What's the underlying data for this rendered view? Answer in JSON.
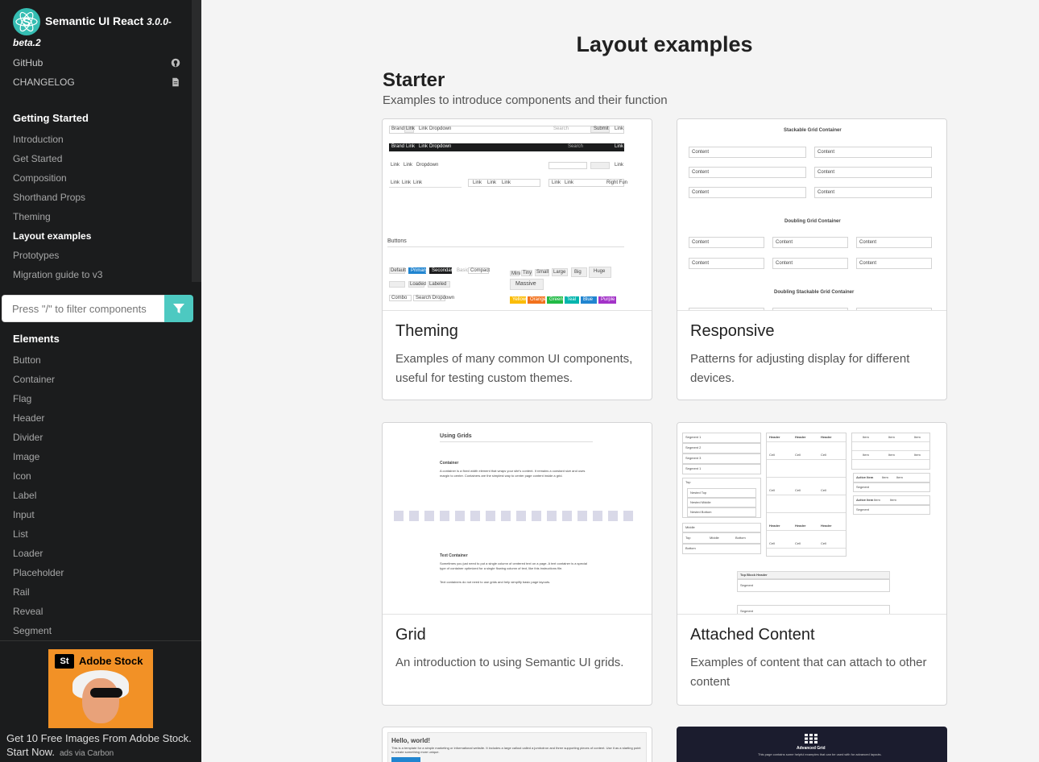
{
  "sidebar": {
    "brand_name": "Semantic UI React",
    "version_a": "3.0.0-",
    "version_b": "beta.2",
    "links": [
      {
        "label": "GitHub"
      },
      {
        "label": "CHANGELOG"
      }
    ],
    "getting_started_header": "Getting Started",
    "getting_started": [
      "Introduction",
      "Get Started",
      "Composition",
      "Shorthand Props",
      "Theming",
      "Layout examples",
      "Prototypes",
      "Migration guide to v3"
    ],
    "filter_placeholder": "Press \"/\" to filter components",
    "elements_header": "Elements",
    "elements": [
      "Button",
      "Container",
      "Flag",
      "Header",
      "Divider",
      "Image",
      "Icon",
      "Label",
      "Input",
      "List",
      "Loader",
      "Placeholder",
      "Rail",
      "Reveal",
      "Segment"
    ]
  },
  "ad": {
    "logo_text": "St",
    "brand": "Adobe Stock",
    "text": "Get 10 Free Images From Adobe Stock. Start Now.",
    "via": "ads via Carbon"
  },
  "main": {
    "title": "Layout examples",
    "section_title": "Starter",
    "section_subtitle": "Examples to introduce components and their function",
    "cards": [
      {
        "title": "Theming",
        "desc": "Examples of many common UI components, useful for testing custom themes."
      },
      {
        "title": "Responsive",
        "desc": "Patterns for adjusting display for different devices."
      },
      {
        "title": "Grid",
        "desc": "An introduction to using Semantic UI grids."
      },
      {
        "title": "Attached Content",
        "desc": "Examples of content that can attach to other content"
      }
    ]
  },
  "thumbs": {
    "theming": {
      "menu": [
        "Brand",
        "Link",
        "Link",
        "Dropdown"
      ],
      "search": "Search",
      "submit": "Submit",
      "link": "Link",
      "tabs": [
        "Link",
        "Link",
        "Link"
      ],
      "right_fun": "Right Fun",
      "buttons_label": "Buttons",
      "buttons": [
        "Default",
        "Primary",
        "Secondary",
        "Basic",
        "Compact"
      ],
      "sizes": [
        "Mini",
        "Tiny",
        "Small",
        "Large",
        "Big",
        "Huge"
      ],
      "massive": "Massive",
      "loaded": "Loaded",
      "labeled": "Labeled",
      "combo": "Combo",
      "search_dropdown": "Search Dropdown",
      "colors": [
        {
          "label": "Yellow",
          "color": "#fbbd08"
        },
        {
          "label": "Orange",
          "color": "#f2711c"
        },
        {
          "label": "Green",
          "color": "#21ba45"
        },
        {
          "label": "Teal",
          "color": "#00b5ad"
        },
        {
          "label": "Blue",
          "color": "#2185d0"
        },
        {
          "label": "Purple",
          "color": "#a333c8"
        }
      ]
    },
    "responsive": {
      "h1": "Stackable Grid Container",
      "h2": "Doubling Grid Container",
      "h3": "Doubling Stackable Grid Container",
      "content": "Content"
    },
    "grid": {
      "h1": "Using Grids",
      "container": "Container",
      "container_text": "A container is a fixed width element that wraps your site's content. It remains a constant size and uses margin to center. Containers are the simplest way to center page content inside a grid.",
      "text_container": "Text Container",
      "text_container_text": "Sometimes you just need to put a single column of centered text on a page. A text container is a special type of container optimized for a single flowing column of text, like this instructions file.",
      "tip": "Text containers do not need to use grids and help simplify basic page layouts."
    },
    "attached": {
      "segments": [
        "Segment 1",
        "Segment 2",
        "Segment 3",
        "Segment 1"
      ],
      "top": "Top",
      "nested": [
        "Nested Top",
        "Nested Middle",
        "Nested Bottom"
      ],
      "middle": "Middle",
      "bottom_row": [
        "Top",
        "Middle",
        "Bottom"
      ],
      "bottom": "Bottom",
      "header": "Header",
      "cell": "Cell",
      "item": "Item",
      "active_item": "Active Item",
      "segment": "Segment",
      "top_block_header": "Top Block Header"
    },
    "bottom_left": {
      "title": "Hello, world!",
      "text": "This is a template for a simple marketing or informational website. It includes a large callout called a jumbotron and three supporting pieces of content. Use it as a starting point to create something more unique."
    },
    "bottom_right": {
      "title": "Advanced Grid",
      "text": "This page contains some helpful examples that can be used with for advanced layouts."
    }
  }
}
